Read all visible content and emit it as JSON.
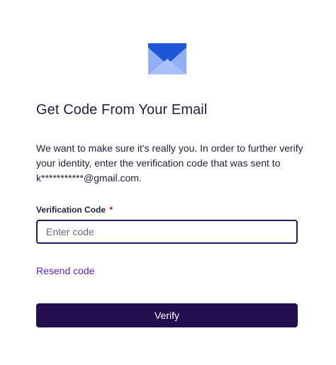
{
  "header": {
    "icon": "envelope-icon",
    "title": "Get Code From Your Email"
  },
  "description": "We want to make sure it's really you. In order to further verify your identity, enter the verification code that was sent to k***********@gmail.com.",
  "form": {
    "code_label": "Verification Code",
    "required_marker": "*",
    "code_placeholder": "Enter code",
    "code_value": ""
  },
  "actions": {
    "resend_label": "Resend code",
    "verify_label": "Verify"
  },
  "colors": {
    "envelope_front": "#1d56d8",
    "envelope_back": "#8fb0f5",
    "input_border": "#2a1659",
    "link": "#5a1fc4",
    "button_bg": "#230e4f",
    "required": "#d0021b"
  }
}
